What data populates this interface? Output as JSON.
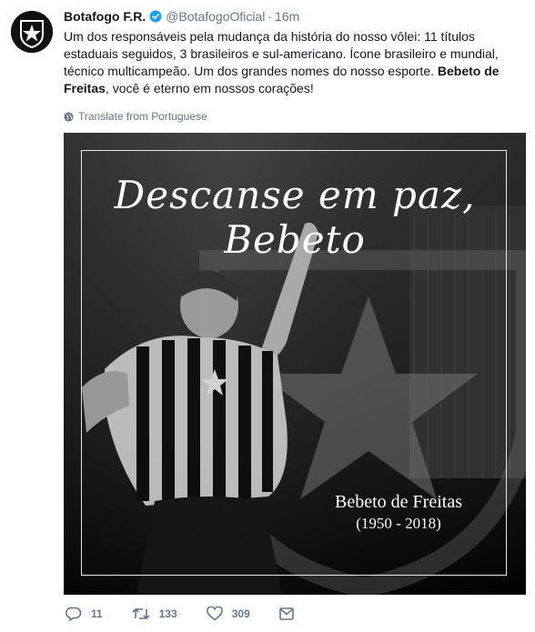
{
  "tweet": {
    "display_name": "Botafogo F.R.",
    "handle": "@BotafogoOficial",
    "separator": "·",
    "time": "16m",
    "text_main": "Um dos responsáveis pela mudança da história do nosso vôlei: 11 títulos estaduais seguidos, 3 brasileiros e sul-americano. Ícone brasileiro e mundial, técnico multicampeão. Um dos grandes nomes do nosso esporte. ",
    "text_bold": "Bebeto de Freitas",
    "text_end": ", você é eterno em nossos corações!",
    "translate_label": "Translate from Portuguese"
  },
  "media": {
    "title": "Descanse em paz, Bebeto",
    "name": "Bebeto de Freitas",
    "years": "(1950 - 2018)"
  },
  "actions": {
    "replies": "11",
    "retweets": "133",
    "likes": "309"
  },
  "icons": {
    "avatar": "botafogo-star-crest",
    "verified": "verified-badge-icon",
    "translate": "globe-icon",
    "reply": "reply-icon",
    "retweet": "retweet-icon",
    "like": "heart-icon",
    "dm": "envelope-icon"
  },
  "colors": {
    "verified": "#1da1f2",
    "muted": "#657786",
    "text": "#14171a"
  }
}
